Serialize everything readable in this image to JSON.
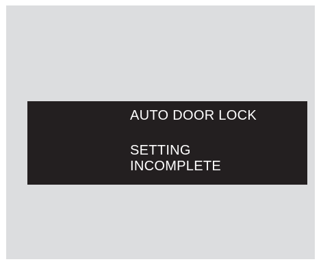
{
  "display": {
    "title": "AUTO DOOR LOCK",
    "status_lines": [
      "SETTING",
      "INCOMPLETE"
    ]
  },
  "colors": {
    "background": "#dcdddf",
    "bar": "#231f20",
    "text": "#ffffff"
  }
}
